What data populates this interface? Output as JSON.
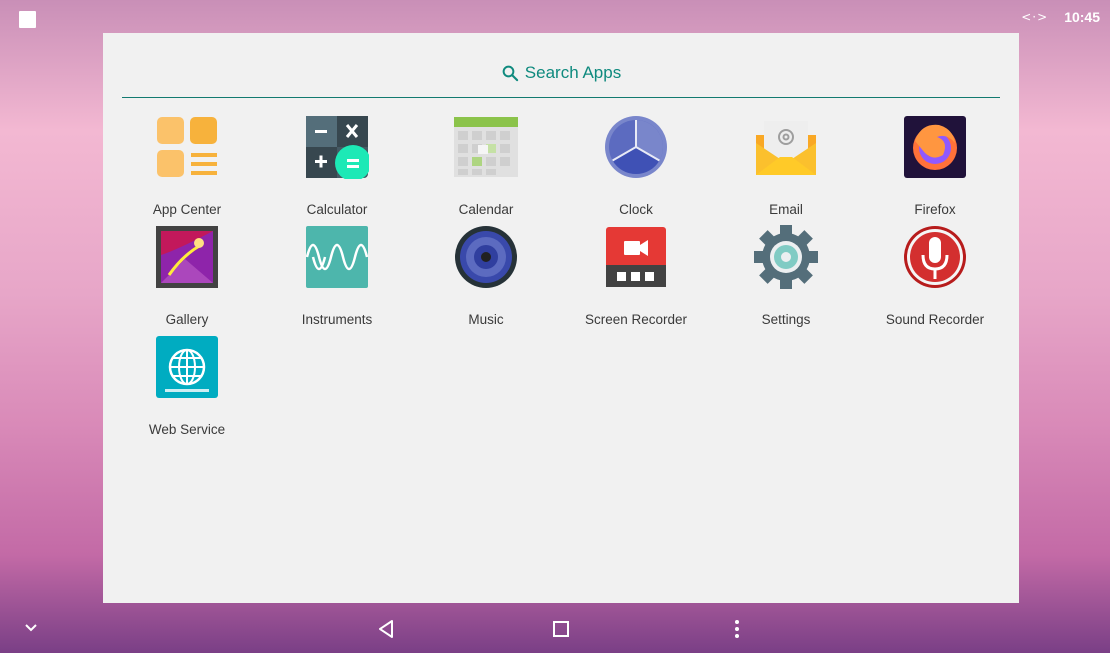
{
  "statusbar": {
    "time": "10:45",
    "sync_symbol": "<·>"
  },
  "search": {
    "label": "Search Apps"
  },
  "apps": [
    {
      "label": "App Center",
      "icon": "app-center-icon"
    },
    {
      "label": "Calculator",
      "icon": "calculator-icon"
    },
    {
      "label": "Calendar",
      "icon": "calendar-icon"
    },
    {
      "label": "Clock",
      "icon": "clock-icon"
    },
    {
      "label": "Email",
      "icon": "email-icon"
    },
    {
      "label": "Firefox",
      "icon": "firefox-icon"
    },
    {
      "label": "Gallery",
      "icon": "gallery-icon"
    },
    {
      "label": "Instruments",
      "icon": "instruments-icon"
    },
    {
      "label": "Music",
      "icon": "music-icon"
    },
    {
      "label": "Screen Recorder",
      "icon": "screen-recorder-icon"
    },
    {
      "label": "Settings",
      "icon": "settings-icon"
    },
    {
      "label": "Sound Recorder",
      "icon": "sound-recorder-icon"
    },
    {
      "label": "Web Service",
      "icon": "web-service-icon"
    }
  ],
  "navbar": {
    "items": [
      "chevron-down-icon",
      "back-icon",
      "recents-icon",
      "more-vert-icon"
    ]
  }
}
